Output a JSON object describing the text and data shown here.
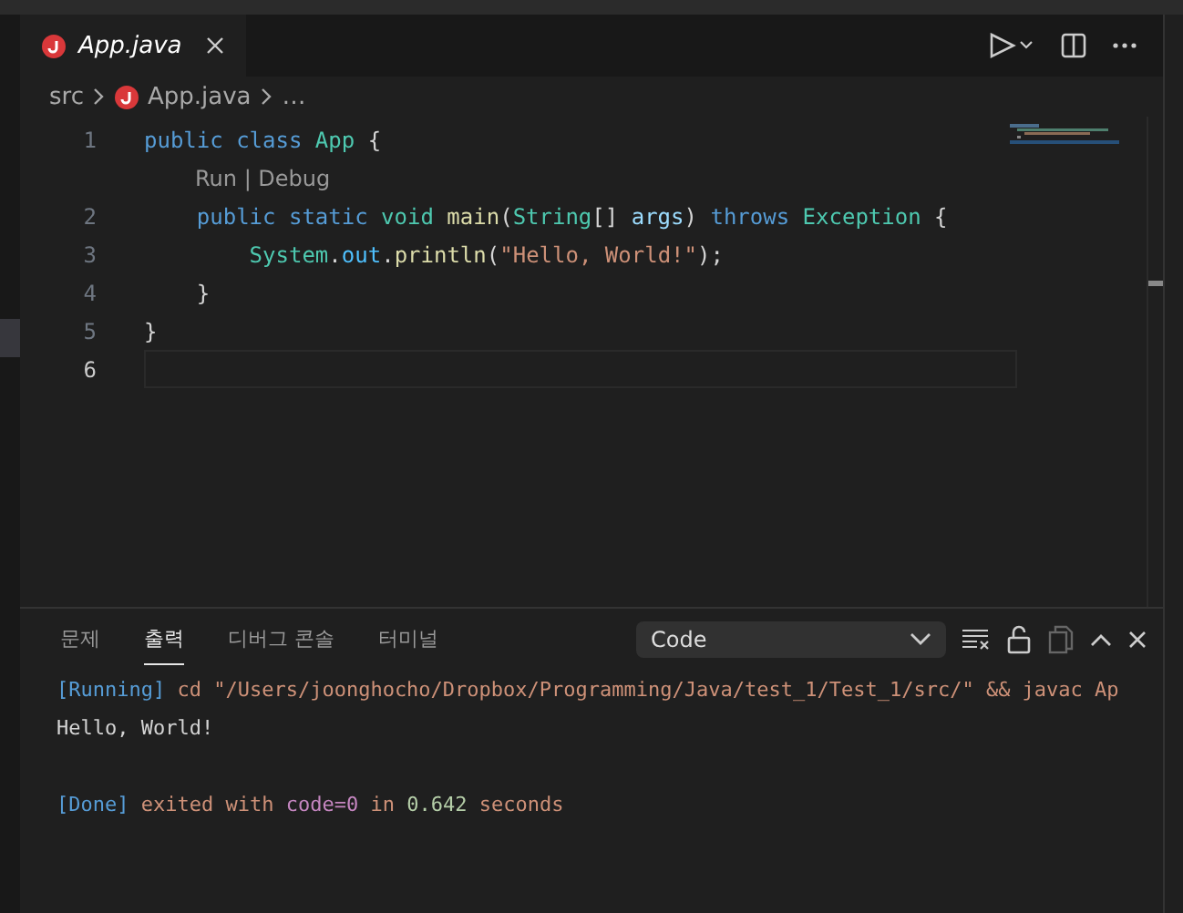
{
  "tabs": [
    {
      "label": "App.java",
      "selected": true
    }
  ],
  "breadcrumb": [
    "src",
    "App.java",
    "…"
  ],
  "code_lines": [
    {
      "number": "1",
      "current": false,
      "tokens": [
        {
          "kind": "keyword",
          "text": "public class "
        },
        {
          "kind": "type",
          "text": "App"
        },
        {
          "kind": "plain",
          "text": " {"
        }
      ]
    },
    {
      "codelens": "Run | Debug",
      "current": false
    },
    {
      "number": "2",
      "current": false,
      "tokens": [
        {
          "kind": "keyword",
          "text": "    public static "
        },
        {
          "kind": "type",
          "text": "void "
        },
        {
          "kind": "function",
          "text": "main"
        },
        {
          "kind": "plain",
          "text": "("
        },
        {
          "kind": "type",
          "text": "String"
        },
        {
          "kind": "plain",
          "text": "[] "
        },
        {
          "kind": "variable",
          "text": "args"
        },
        {
          "kind": "plain",
          "text": ") "
        },
        {
          "kind": "keyword",
          "text": "throws "
        },
        {
          "kind": "type",
          "text": "Exception"
        },
        {
          "kind": "plain",
          "text": " {"
        }
      ]
    },
    {
      "number": "3",
      "current": false,
      "tokens": [
        {
          "kind": "type",
          "text": "        System"
        },
        {
          "kind": "plain",
          "text": "."
        },
        {
          "kind": "field",
          "text": "out"
        },
        {
          "kind": "plain",
          "text": "."
        },
        {
          "kind": "function",
          "text": "println"
        },
        {
          "kind": "plain",
          "text": "("
        },
        {
          "kind": "string",
          "text": "\"Hello, World!\""
        },
        {
          "kind": "plain",
          "text": ");"
        }
      ]
    },
    {
      "number": "4",
      "current": false,
      "tokens": [
        {
          "kind": "plain",
          "text": "    }"
        }
      ]
    },
    {
      "number": "5",
      "current": false,
      "tokens": [
        {
          "kind": "plain",
          "text": "}"
        }
      ]
    },
    {
      "number": "6",
      "current": true
    }
  ],
  "panel": {
    "tabs": [
      {
        "label": "문제",
        "selected": false
      },
      {
        "label": "출력",
        "selected": true
      },
      {
        "label": "디버그 콘솔",
        "selected": false
      },
      {
        "label": "터미널",
        "selected": false
      }
    ],
    "channel": "Code",
    "output_blocks": [
      {
        "lines": [
          [
            {
              "kind": "tag",
              "text": "[Running]"
            },
            {
              "kind": "text",
              "text": " cd \"/Users/joonghocho/Dropbox/Programming/Java/test_1/Test_1/src/\" && javac Ap"
            }
          ],
          [
            {
              "kind": "plain",
              "text": "Hello, World!"
            }
          ]
        ]
      },
      {
        "lines": [
          [
            {
              "kind": "tag",
              "text": "[Done]"
            },
            {
              "kind": "text",
              "text": " exited with "
            },
            {
              "kind": "code",
              "text": "code=0"
            },
            {
              "kind": "text",
              "text": " in "
            },
            {
              "kind": "number",
              "text": "0.642"
            },
            {
              "kind": "text",
              "text": " seconds"
            }
          ]
        ]
      }
    ]
  }
}
